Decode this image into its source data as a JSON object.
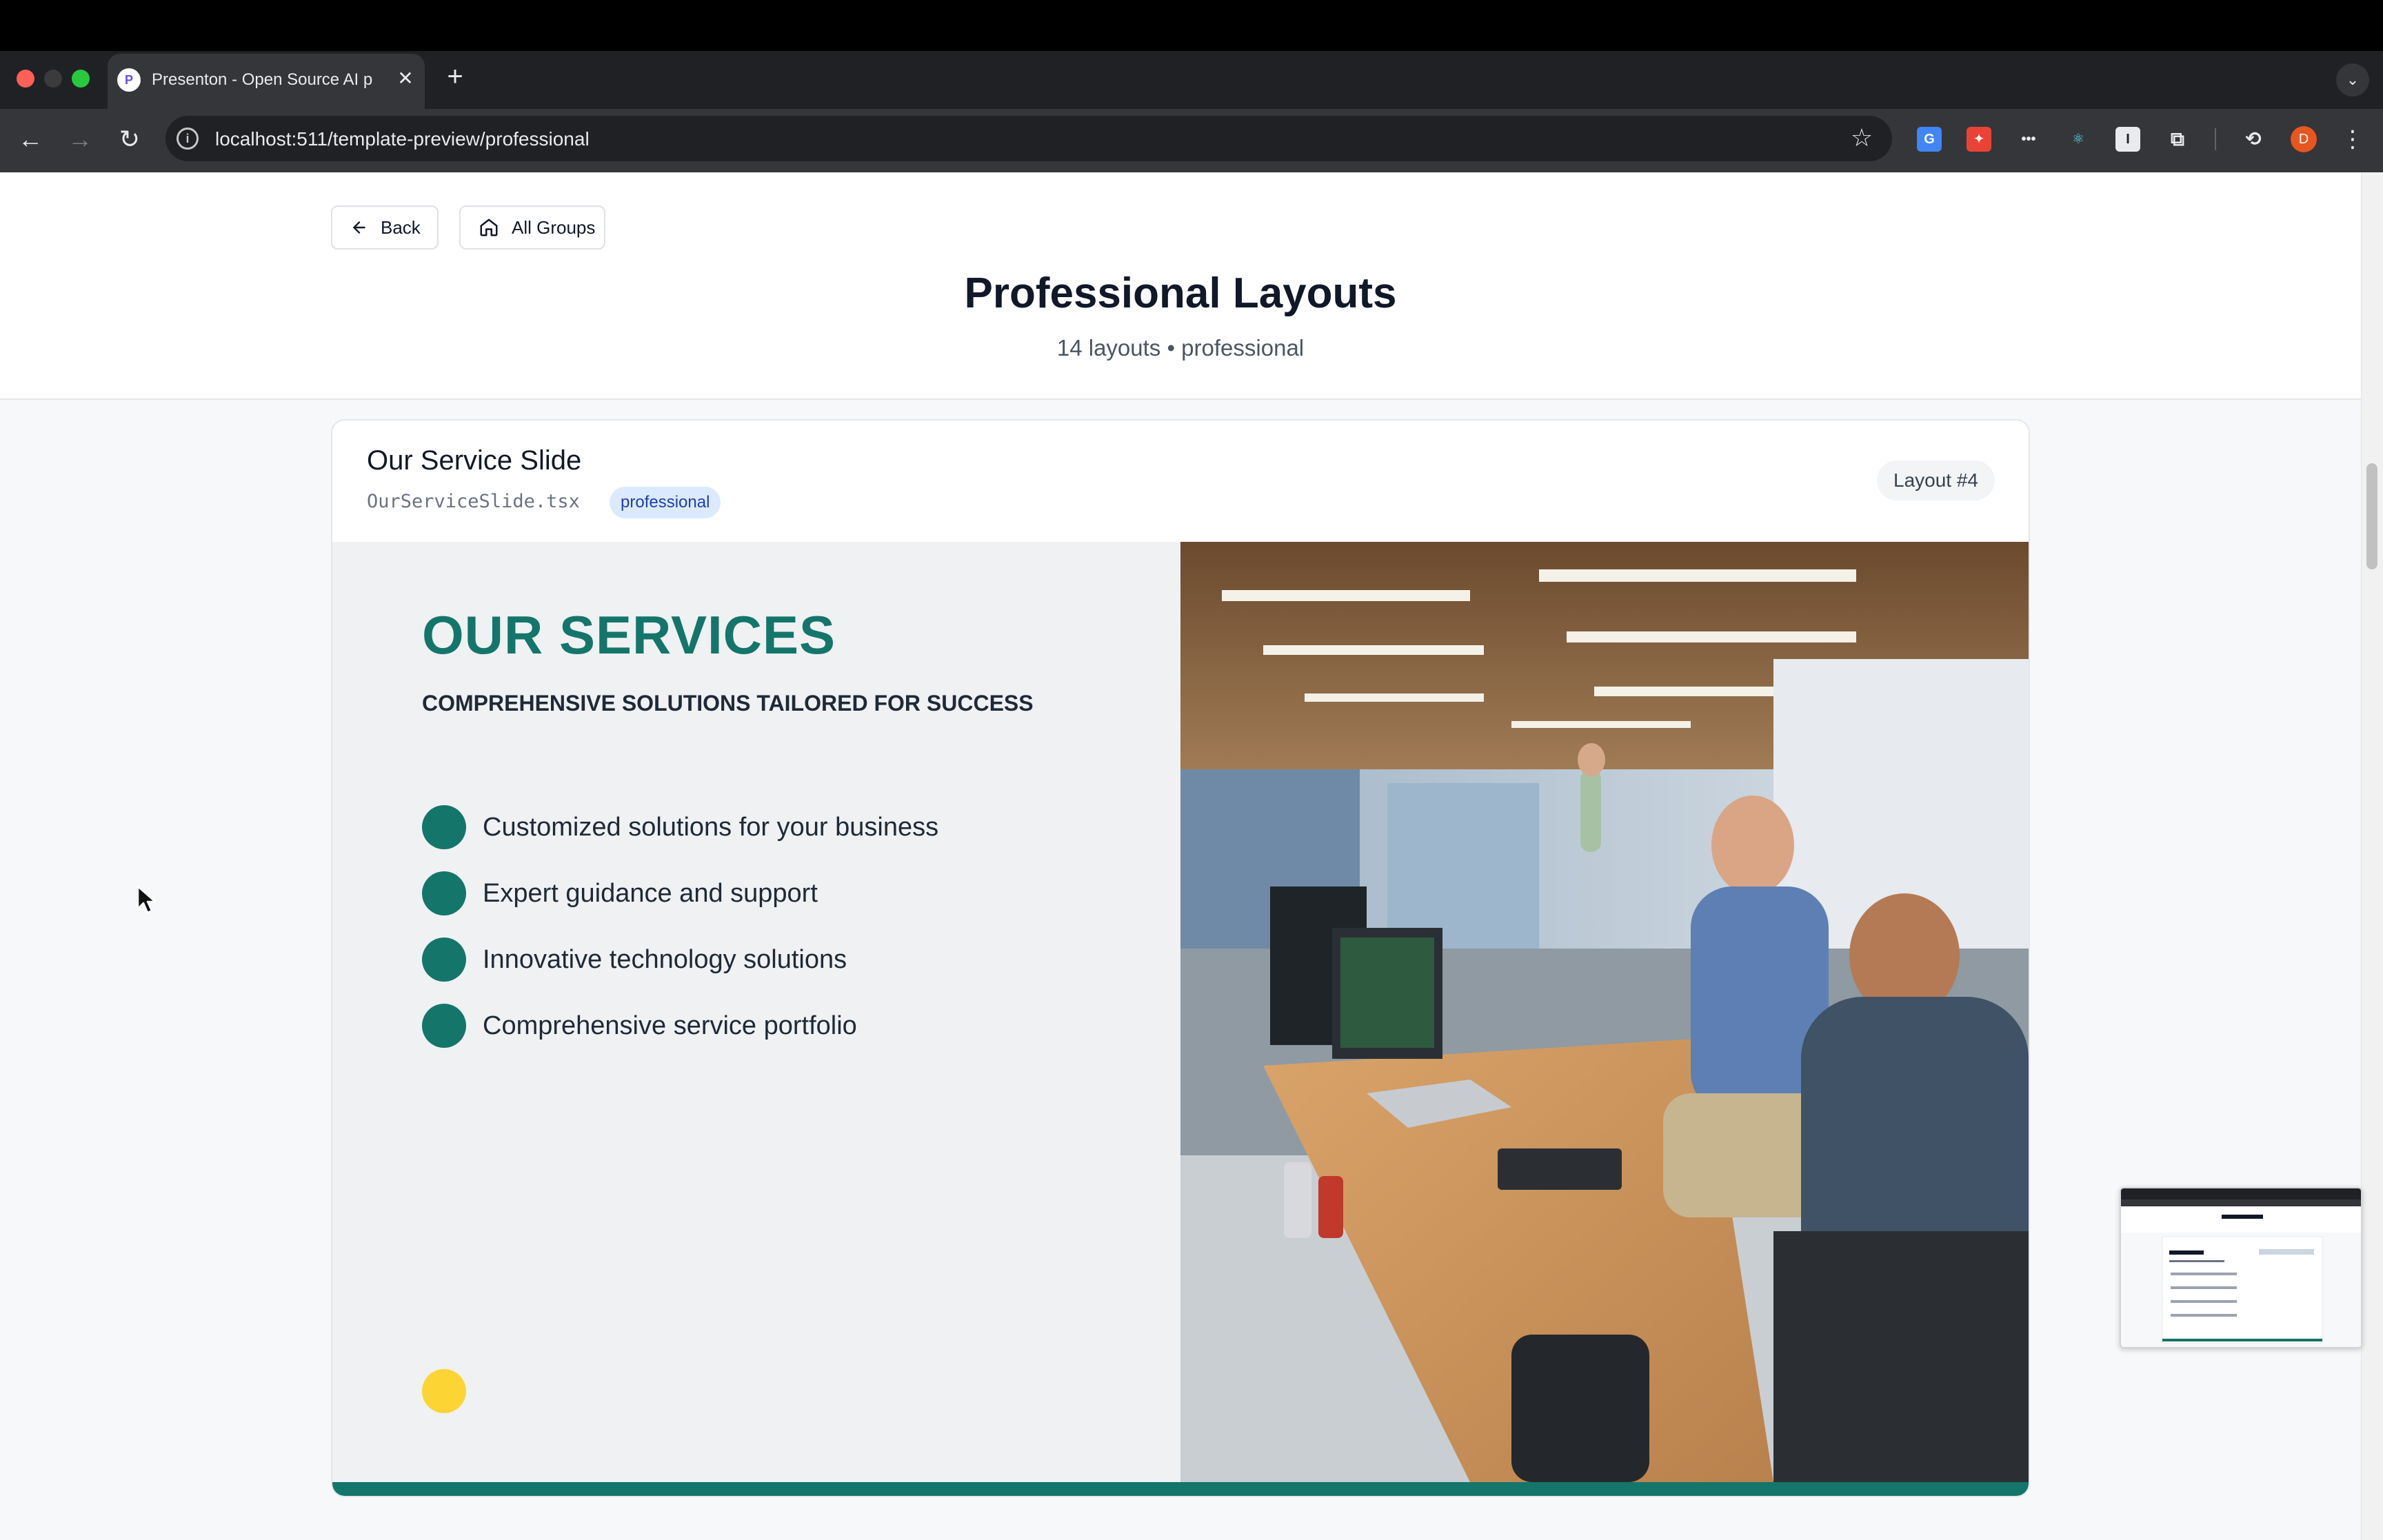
{
  "browser": {
    "tab_title": "Presenton - Open Source AI p",
    "tab_favicon": "P",
    "url": "localhost:511/template-preview/professional",
    "profile_initial": "D",
    "extension_icons": [
      "translate-icon",
      "rocket-icon",
      "dots-icon",
      "react-icon",
      "text-i-icon",
      "puzzle-icon",
      "sync-icon"
    ]
  },
  "header": {
    "back_label": "Back",
    "groups_label": "All Groups",
    "title": "Professional Layouts",
    "subtitle": "14 layouts • professional"
  },
  "card": {
    "title": "Our Service Slide",
    "file": "OurServiceSlide.tsx",
    "tag": "professional",
    "badge": "Layout #4"
  },
  "slide": {
    "heading": "OUR SERVICES",
    "subheading": "COMPREHENSIVE SOLUTIONS TAILORED FOR SUCCESS",
    "bullets": [
      "Customized solutions for your business",
      "Expert guidance and support",
      "Innovative technology solutions",
      "Comprehensive service portfolio"
    ],
    "accent_color": "#14756b",
    "highlight_color": "#fcd535"
  }
}
